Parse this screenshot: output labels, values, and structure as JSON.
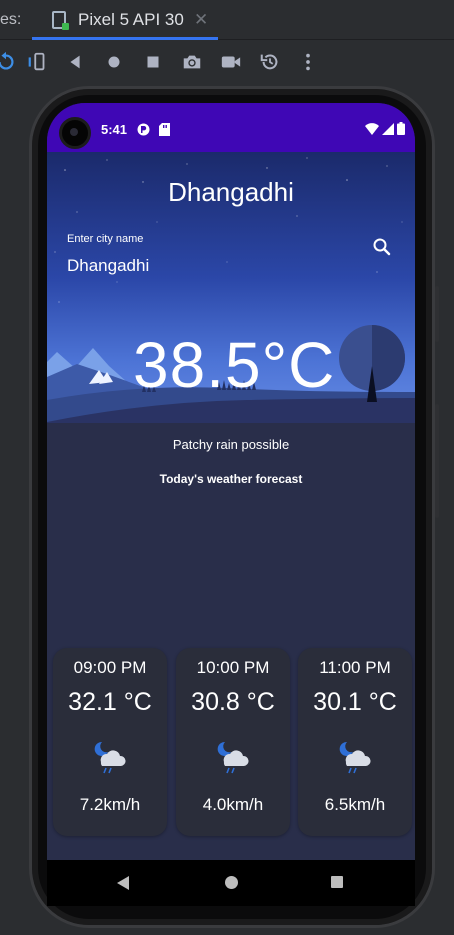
{
  "ide": {
    "tab_prefix": "es:",
    "device_tab_label": "Pixel 5 API 30",
    "close_glyph": "✕"
  },
  "status_bar": {
    "time": "5:41"
  },
  "weather": {
    "city_title": "Dhangadhi",
    "search_label": "Enter city name",
    "search_value": "Dhangadhi",
    "temperature": "38.5°C",
    "condition": "Patchy rain possible",
    "forecast_title": "Today's weather forecast",
    "forecast": [
      {
        "time": "09:00 PM",
        "temp": "32.1 °C",
        "wind": "7.2km/h",
        "icon": "night-rain-cloud-icon"
      },
      {
        "time": "10:00 PM",
        "temp": "30.8 °C",
        "wind": "4.0km/h",
        "icon": "night-rain-cloud-icon"
      },
      {
        "time": "11:00 PM",
        "temp": "30.1 °C",
        "wind": "6.5km/h",
        "icon": "night-rain-cloud-icon"
      }
    ]
  },
  "colors": {
    "status_bar": "#3f07b5",
    "background": "#292e4a",
    "card": "#2a2d3a",
    "ide_accent": "#3574f0"
  }
}
